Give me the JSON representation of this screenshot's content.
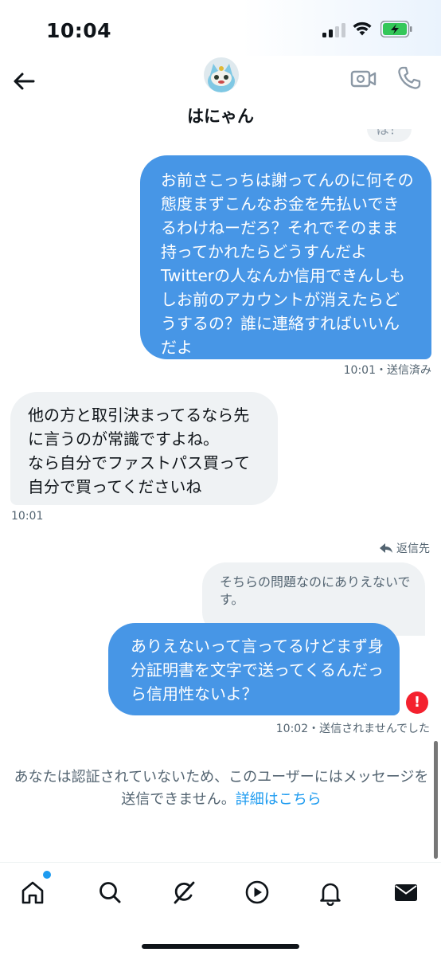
{
  "status": {
    "time": "10:04"
  },
  "header": {
    "name": "はにゃん"
  },
  "conversation": {
    "peek_text": "ば！",
    "messages": [
      {
        "direction": "outgoing",
        "text": "お前さこっちは謝ってんのに何その態度まずこんなお金を先払いできるわけねーだろ？それでそのまま持ってかれたらどうすんだよTwitterの人なんか信用できんしもしお前のアカウントが消えたらどうするの？誰に連絡すればいいんだよ",
        "meta": "10:01・送信済み"
      },
      {
        "direction": "incoming",
        "text": "他の方と取引決まってるなら先に言うのが常識ですよね。\nなら自分でファストパス買って自分で買ってくださいね",
        "meta": "10:01"
      },
      {
        "direction": "outgoing",
        "reply_label": "返信先",
        "quoted_text": "そちらの問題なのにありえないです。",
        "text": "ありえないって言ってるけどまず身分証明書を文字で送ってくるんだっら信用性ないよ？",
        "meta": "10:02・送信されませんでした",
        "error_icon": "!"
      }
    ]
  },
  "notice": {
    "text": "あなたは認証されていないため、このユーザーにはメッセージを送信できません。",
    "link": "詳細はこちら"
  },
  "nav": {
    "items": [
      "home-icon",
      "search-icon",
      "grok-icon",
      "video-icon",
      "bell-icon",
      "mail-icon"
    ]
  },
  "colors": {
    "outgoing_bubble": "#4796e6",
    "incoming_bubble": "#eff2f4",
    "link": "#1d9bf0",
    "error": "#f4212e"
  }
}
